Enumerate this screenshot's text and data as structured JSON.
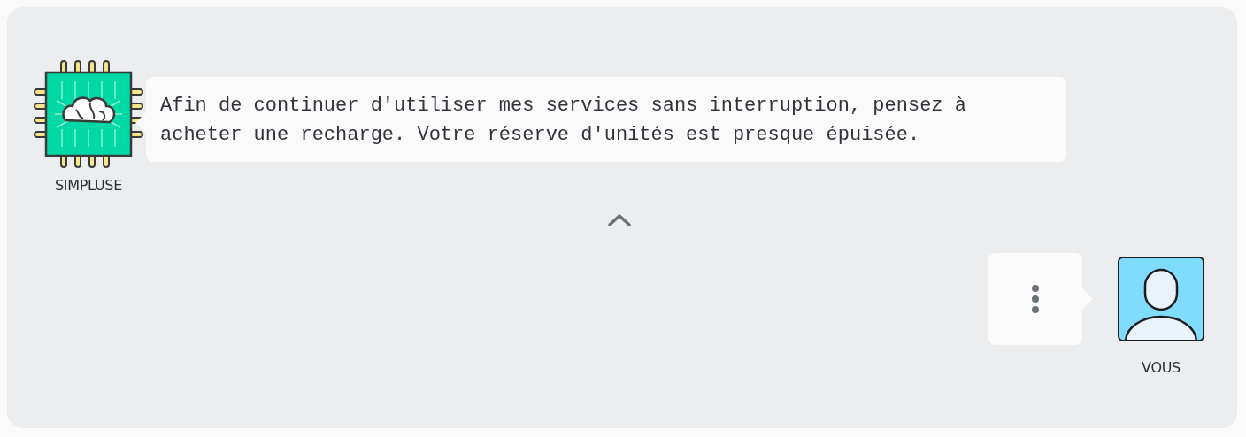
{
  "messages": [
    {
      "kind": "bot",
      "author": "SIMPLUSE",
      "text": "Afin de continuer d'utiliser mes services sans interruption, pensez à acheter une recharge. Votre réserve d'unités est presque épuisée."
    },
    {
      "kind": "user",
      "author": "VOUS",
      "typing": true
    }
  ]
}
